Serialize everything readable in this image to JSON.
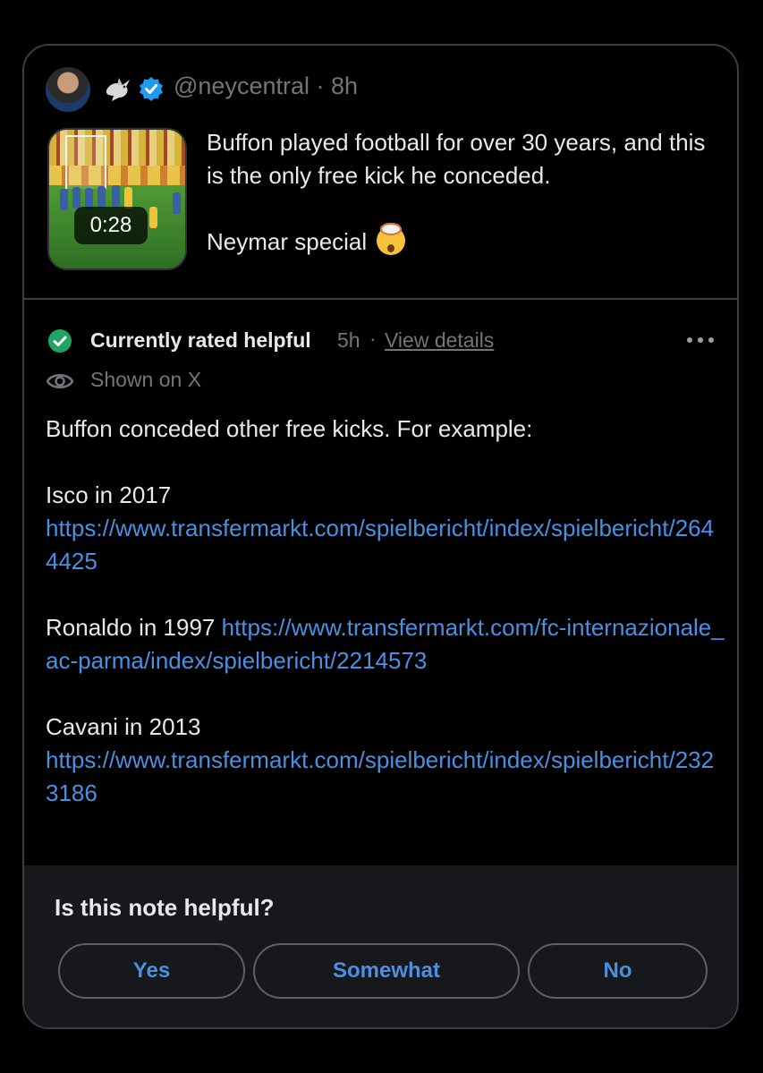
{
  "tweet": {
    "handle": "@neycentral",
    "separator": "·",
    "time": "8h",
    "video_duration": "0:28",
    "text_line1": "Buffon played football for over 30 years, and this is the only free kick he conceded.",
    "text_line2": "Neymar special",
    "icons": [
      "avatar",
      "dove-icon",
      "verified-badge-icon",
      "exploding-head-emoji"
    ]
  },
  "note": {
    "status": "Currently rated helpful",
    "time": "5h",
    "separator": "·",
    "view_details": "View details",
    "shown_on": "Shown on X",
    "intro": "Buffon conceded other free kicks. For example:",
    "examples": [
      {
        "label": "Isco in 2017",
        "url": "https://www.transfermarkt.com/spielbericht/index/spielbericht/2644425"
      },
      {
        "label": "Ronaldo in 1997",
        "url": "https://www.transfermarkt.com/fc-internazionale_ac-parma/index/spielbericht/2214573"
      },
      {
        "label": "Cavani in 2013",
        "url": "https://www.transfermarkt.com/spielbericht/index/spielbericht/2323186"
      }
    ],
    "icons": [
      "check-circle-icon",
      "eye-icon",
      "more-options-icon"
    ]
  },
  "feedback": {
    "question": "Is this note helpful?",
    "yes": "Yes",
    "somewhat": "Somewhat",
    "no": "No"
  },
  "colors": {
    "background": "#000000",
    "border": "#3a3d41",
    "text": "#e7e9ea",
    "muted": "#71767b",
    "link": "#4a90e2",
    "verified": "#1d9bf0",
    "helpful_green": "#1fa463",
    "feedback_bg": "#16181c"
  }
}
